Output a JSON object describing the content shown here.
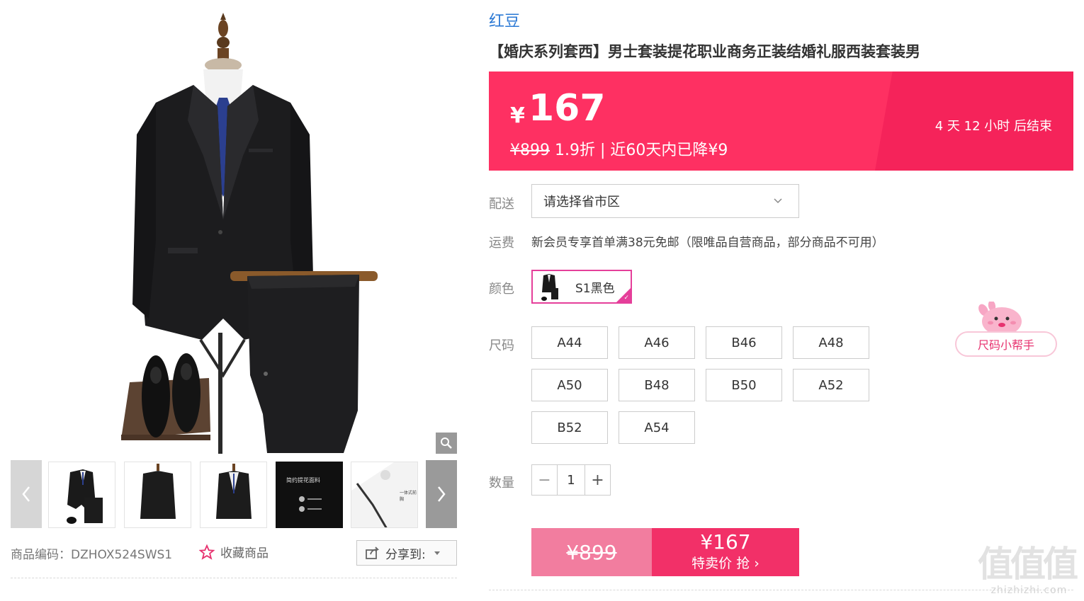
{
  "gallery": {
    "zoom_icon": "magnifier-icon",
    "thumbs": [
      {
        "name": "suit-set-with-shoes"
      },
      {
        "name": "jacket-back"
      },
      {
        "name": "jacket-front"
      },
      {
        "name": "fabric-detail",
        "text": "简约提花面料"
      },
      {
        "name": "craft-detail",
        "text": "一体式前胸"
      }
    ],
    "prev_icon": "chevron-left-icon",
    "next_icon": "chevron-right-icon"
  },
  "meta": {
    "sku": "商品编码：DZHOX524SWS1",
    "favorite": "收藏商品",
    "share": "分享到:"
  },
  "product": {
    "brand": "红豆",
    "title": "【婚庆系列套西】男士套装提花职业商务正装结婚礼服西装套装男"
  },
  "price": {
    "currency": "¥",
    "current": "167",
    "original": "¥899",
    "discount_text": " 1.9折 | 近60天内已降¥9",
    "countdown": "4  天  12  小时  后结束",
    "banner_color": "#fe3062"
  },
  "delivery": {
    "label": "配送",
    "select_value": "请选择省市区"
  },
  "freight": {
    "label": "运费",
    "text": "新会员专享首单满38元免邮（限唯品自营商品，部分商品不可用）"
  },
  "color": {
    "label": "颜色",
    "options": [
      {
        "label": "S1黑色",
        "selected": true
      }
    ],
    "accent": "#e53f9a"
  },
  "size": {
    "label": "尺码",
    "options": [
      "A44",
      "A46",
      "B46",
      "A48",
      "A50",
      "B48",
      "B50",
      "A52",
      "B52",
      "A54"
    ],
    "helper": "尺码小帮手"
  },
  "quantity": {
    "label": "数量",
    "value": "1",
    "minus": "−",
    "plus": "+"
  },
  "buy": {
    "original": "¥899",
    "price": "¥167",
    "cta": "特卖价 抢 ›"
  },
  "watermark": {
    "chars": "值值值",
    "url": "zhizhizhi.com"
  }
}
